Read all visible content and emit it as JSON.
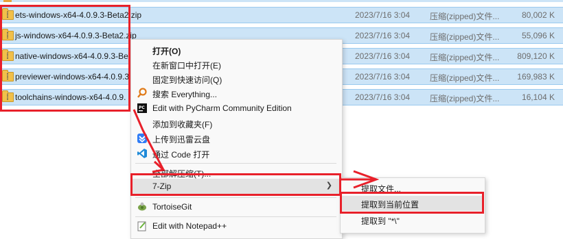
{
  "files": [
    {
      "name": "ets-windows-x64-4.0.9.3-Beta2.zip",
      "date": "2023/7/16 3:04",
      "type": "压缩(zipped)文件...",
      "size": "80,002 K"
    },
    {
      "name": "js-windows-x64-4.0.9.3-Beta2.zip",
      "date": "2023/7/16 3:04",
      "type": "压缩(zipped)文件...",
      "size": "55,096 K"
    },
    {
      "name": "native-windows-x64-4.0.9.3-Be",
      "date": "2023/7/16 3:04",
      "type": "压缩(zipped)文件...",
      "size": "809,120 K"
    },
    {
      "name": "previewer-windows-x64-4.0.9.3",
      "date": "2023/7/16 3:04",
      "type": "压缩(zipped)文件...",
      "size": "169,983 K"
    },
    {
      "name": "toolchains-windows-x64-4.0.9.",
      "date": "2023/7/16 3:04",
      "type": "压缩(zipped)文件...",
      "size": "16,104 K"
    }
  ],
  "context_menu": {
    "open": "打开(O)",
    "open_new_window": "在新窗口中打开(E)",
    "pin_quick_access": "固定到快速访问(Q)",
    "search_everything": "搜索 Everything...",
    "edit_pycharm": "Edit with PyCharm Community Edition",
    "add_favorites": "添加到收藏夹(F)",
    "upload_thunder": "上传到迅雷云盘",
    "open_vscode": "通过 Code 打开",
    "extract_all": "全部解压缩(T)...",
    "seven_zip": "7-Zip",
    "tortoisegit": "TortoiseGit",
    "edit_notepad": "Edit with Notepad++"
  },
  "submenu": {
    "extract_files": "提取文件...",
    "extract_here": "提取到当前位置",
    "extract_to": "提取到 \"*\\\""
  },
  "colors": {
    "selection": "#cce4f7",
    "annotation_red": "#e8202a",
    "menu_bg": "#f9f9f9"
  }
}
